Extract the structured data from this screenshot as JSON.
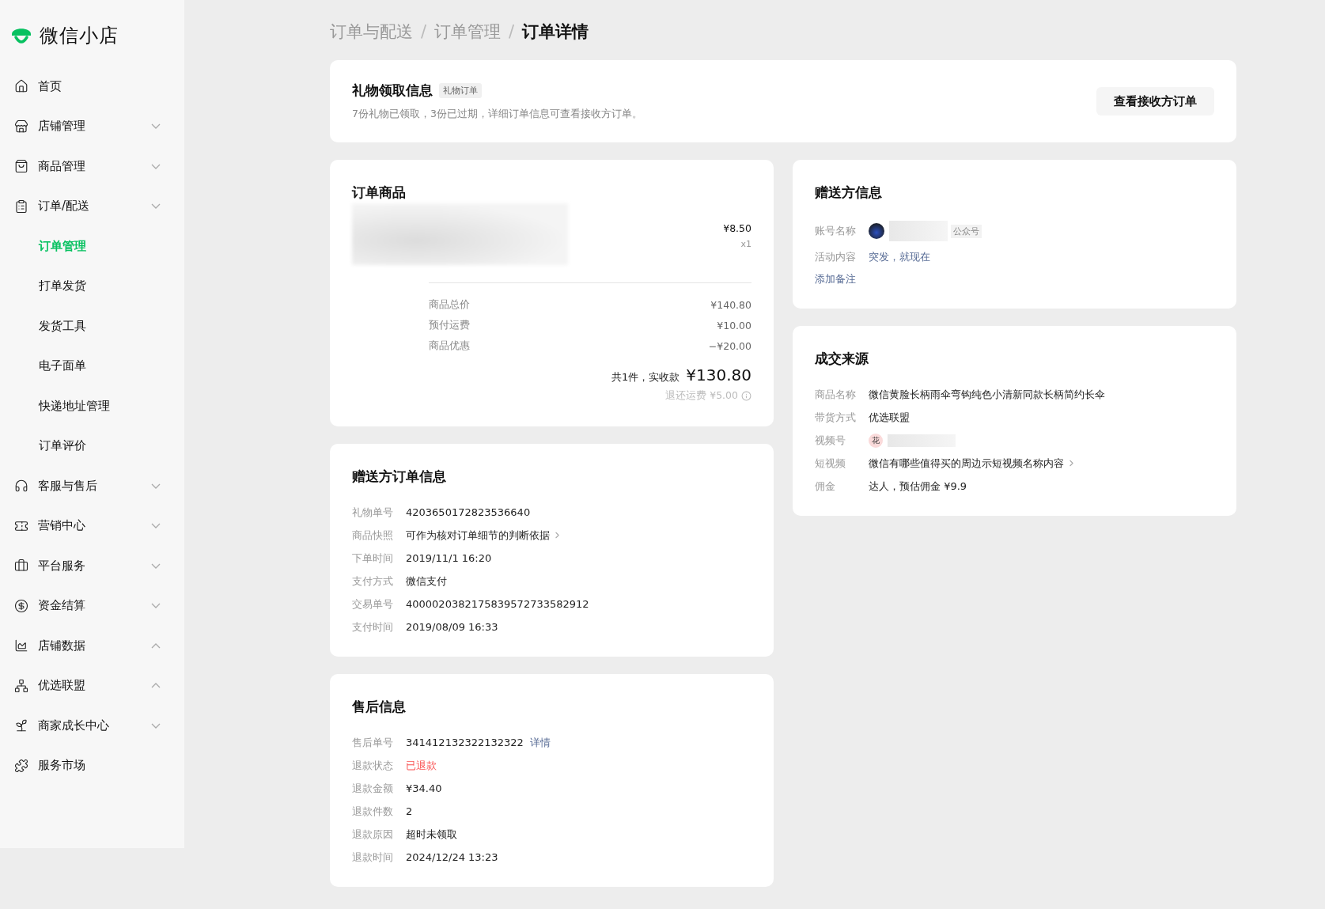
{
  "logo": {
    "name": "微信小店"
  },
  "sidebar": {
    "items": [
      {
        "label": "首页",
        "kind": "link"
      },
      {
        "label": "店铺管理",
        "kind": "group",
        "expanded": false
      },
      {
        "label": "商品管理",
        "kind": "group",
        "expanded": false
      },
      {
        "label": "订单/配送",
        "kind": "group",
        "expanded": false,
        "children": [
          {
            "label": "订单管理",
            "selected": true
          },
          {
            "label": "打单发货",
            "selected": false
          },
          {
            "label": "发货工具",
            "selected": false
          },
          {
            "label": "电子面单",
            "selected": false
          },
          {
            "label": "快递地址管理",
            "selected": false
          },
          {
            "label": "订单评价",
            "selected": false
          }
        ]
      },
      {
        "label": "客服与售后",
        "kind": "group",
        "expanded": false
      },
      {
        "label": "营销中心",
        "kind": "group",
        "expanded": false
      },
      {
        "label": "平台服务",
        "kind": "group",
        "expanded": false
      },
      {
        "label": "资金结算",
        "kind": "group",
        "expanded": false
      },
      {
        "label": "店铺数据",
        "kind": "group",
        "expanded": true
      },
      {
        "label": "优选联盟",
        "kind": "group",
        "expanded": true
      },
      {
        "label": "商家成长中心",
        "kind": "group",
        "expanded": false
      },
      {
        "label": "服务市场",
        "kind": "link"
      }
    ]
  },
  "breadcrumb_separator": "/",
  "breadcrumb": [
    {
      "label": "订单与配送",
      "current": false
    },
    {
      "label": "订单管理",
      "current": false
    },
    {
      "label": "订单详情",
      "current": true
    }
  ],
  "gift_card": {
    "title": "礼物领取信息",
    "tag": "礼物订单",
    "description": "7份礼物已领取，3份已过期，详细订单信息可查看接收方订单。",
    "button": "查看接收方订单"
  },
  "order_goods": {
    "title": "订单商品",
    "price": "¥8.50",
    "quantity": "x1",
    "summary": [
      {
        "label": "商品总价",
        "value": "¥140.80"
      },
      {
        "label": "预付运费",
        "value": "¥10.00"
      },
      {
        "label": "商品优惠",
        "value": "−¥20.00"
      }
    ],
    "total_label": "共1件，实收款",
    "total_value": "¥130.80",
    "refund_note": "退还运费 ¥5.00"
  },
  "sender_order": {
    "title": "赠送方订单信息",
    "rows": [
      {
        "label": "礼物单号",
        "value": "4203650172823536640",
        "kind": "text"
      },
      {
        "label": "商品快照",
        "value": "可作为核对订单细节的判断依据",
        "kind": "chevron"
      },
      {
        "label": "下单时间",
        "value": "2019/11/1   16:20",
        "kind": "text"
      },
      {
        "label": "支付方式",
        "value": "微信支付",
        "kind": "text"
      },
      {
        "label": "交易单号",
        "value": "4000020382175839572733582912",
        "kind": "text"
      },
      {
        "label": "支付时间",
        "value": "2019/08/09   16:33",
        "kind": "text"
      }
    ]
  },
  "after_sale": {
    "title": "售后信息",
    "rows": [
      {
        "label": "售后单号",
        "value": "341412132322132322",
        "kind": "text",
        "link": "详情"
      },
      {
        "label": "退款状态",
        "value": "已退款",
        "kind": "alert"
      },
      {
        "label": "退款金额",
        "value": "¥34.40",
        "kind": "text"
      },
      {
        "label": "退款件数",
        "value": "2",
        "kind": "text"
      },
      {
        "label": "退款原因",
        "value": "超时未领取",
        "kind": "text"
      },
      {
        "label": "退款时间",
        "value": "2024/12/24 13:23",
        "kind": "text"
      }
    ]
  },
  "sender_info": {
    "title": "赠送方信息",
    "rows": [
      {
        "label": "账号名称",
        "kind": "account",
        "tag": "公众号"
      },
      {
        "label": "活动内容",
        "value": "突发，就现在",
        "kind": "link"
      }
    ],
    "add_note": "添加备注"
  },
  "deal_source": {
    "title": "成交来源",
    "rows": [
      {
        "label": "商品名称",
        "value": "微信黄脸长柄雨伞弯钩纯色小清新同款长柄简约长伞",
        "kind": "text"
      },
      {
        "label": "带货方式",
        "value": "优选联盟",
        "kind": "text"
      },
      {
        "label": "视频号",
        "kind": "channel",
        "avatar": "花"
      },
      {
        "label": "短视频",
        "value": "微信有哪些值得买的周边示短视频名称内容",
        "kind": "chevron"
      },
      {
        "label": "佣金",
        "value": "达人，预估佣金 ¥9.9",
        "kind": "text"
      }
    ]
  }
}
